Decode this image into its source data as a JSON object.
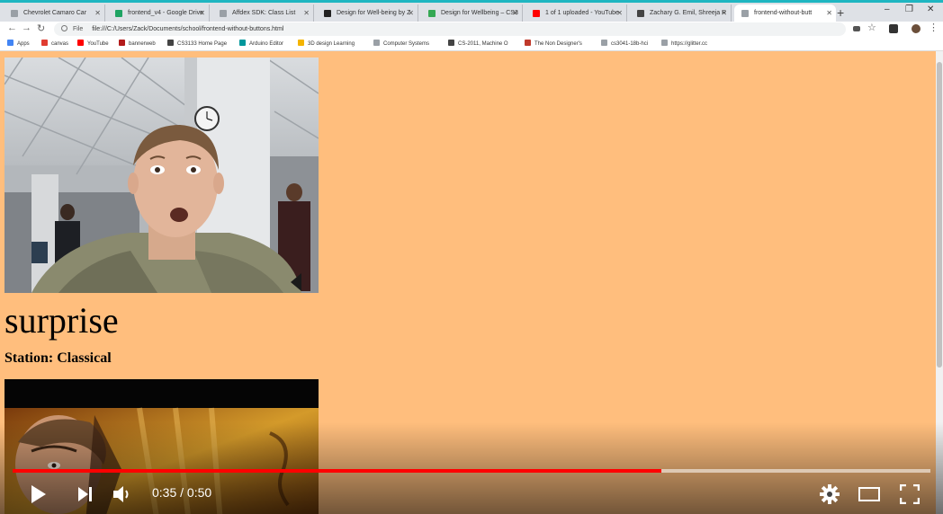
{
  "browser": {
    "tabs": [
      {
        "label": "Chevrolet Camaro Car",
        "icon": "page-icon",
        "color": "#9aa0a6",
        "active": false
      },
      {
        "label": "frontend_v4 - Google Drive",
        "icon": "drive-icon",
        "color": "#1fa463",
        "active": false
      },
      {
        "label": "Affdex SDK: Class List",
        "icon": "page-icon",
        "color": "#9aa0a6",
        "active": false
      },
      {
        "label": "Design for Well-being by Z",
        "icon": "medium-icon",
        "color": "#222222",
        "active": false
      },
      {
        "label": "Design for Wellbeing – CS3",
        "icon": "slides-icon",
        "color": "#34a853",
        "active": false
      },
      {
        "label": "1 of 1 uploaded - YouTube",
        "icon": "youtube-icon",
        "color": "#ff0000",
        "active": false
      },
      {
        "label": "Zachary G. Emil, Shreeja R",
        "icon": "doc-icon",
        "color": "#444444",
        "active": false
      },
      {
        "label": "frontend-without-butt",
        "icon": "page-icon",
        "color": "#9aa0a6",
        "active": true
      }
    ],
    "url_scheme": "File",
    "url": "file:///C:/Users/Zack/Documents/school/frontend-without-buttons.html",
    "bookmarks": [
      {
        "label": "Apps",
        "color": "#4285f4"
      },
      {
        "label": "canvas",
        "color": "#e03c31"
      },
      {
        "label": "YouTube",
        "color": "#ff0000"
      },
      {
        "label": "bannerweb",
        "color": "#b31b1b"
      },
      {
        "label": "CS3133 Home Page",
        "color": "#444444"
      },
      {
        "label": "Arduino Editor",
        "color": "#00979c"
      },
      {
        "label": "3D design Learning",
        "color": "#f4b400"
      },
      {
        "label": "Computer Systems",
        "color": "#9aa0a6"
      },
      {
        "label": "CS-2011, Machine O",
        "color": "#444444"
      },
      {
        "label": "The Non Designer's",
        "color": "#c0392b"
      },
      {
        "label": "cs3041-18b-hci",
        "color": "#9aa0a6"
      },
      {
        "label": "https://glitter.cc",
        "color": "#9aa0a6"
      }
    ]
  },
  "page": {
    "emotion": "surprise",
    "station": "Station: Classical",
    "background": "#ffbe7d"
  },
  "player": {
    "current_time": "0:35",
    "separator": " / ",
    "duration": "0:50",
    "progress": 0.707,
    "accent": "#ff0000"
  }
}
